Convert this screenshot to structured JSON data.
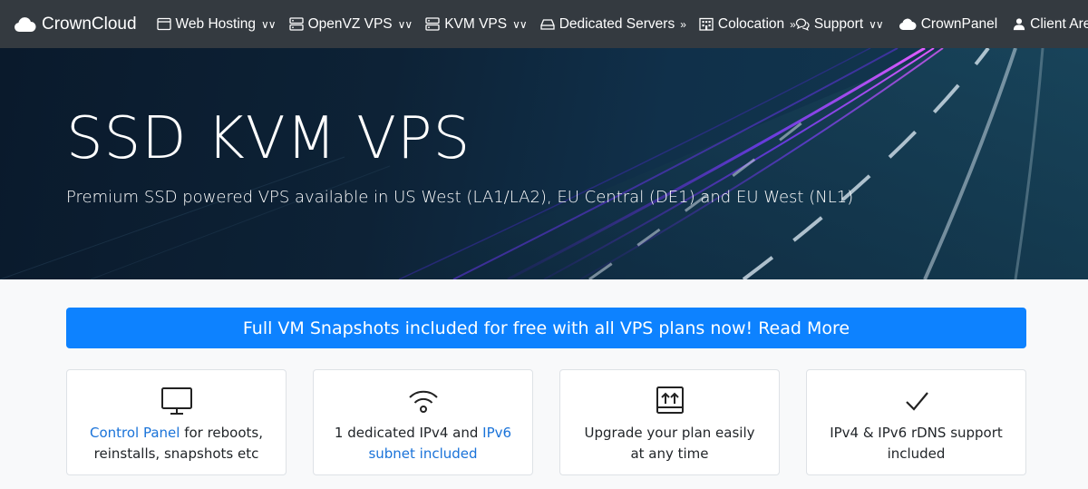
{
  "nav": {
    "brand": "CrownCloud",
    "left": [
      {
        "label": "Web Hosting",
        "icon": "browser-window-icon"
      },
      {
        "label": "OpenVZ VPS",
        "icon": "server-icon"
      },
      {
        "label": "KVM VPS",
        "icon": "server-icon"
      },
      {
        "label": "Dedicated Servers",
        "icon": "hard-drive-icon"
      },
      {
        "label": "Colocation",
        "icon": "building-icon"
      }
    ],
    "right": [
      {
        "label": "Support",
        "icon": "chat-bubbles-icon"
      },
      {
        "label": "CrownPanel",
        "icon": "cloud-icon"
      },
      {
        "label": "Client Area",
        "icon": "user-icon"
      }
    ]
  },
  "hero": {
    "title": "SSD KVM VPS",
    "subtitle": "Premium SSD powered VPS available in US West (LA1/LA2), EU Central (DE1) and EU West (NL1)"
  },
  "banner": {
    "label": "Full VM Snapshots included for free with all VPS plans now! Read More"
  },
  "features": [
    {
      "icon": "monitor-icon",
      "link": "Control Panel",
      "text": " for reboots, reinstalls, snapshots etc"
    },
    {
      "icon": "wifi-icon",
      "pre": "1 dedicated IPv4 and ",
      "link": "IPv6 subnet included"
    },
    {
      "icon": "upgrade-arrows-icon",
      "text": "Upgrade your plan easily at any time"
    },
    {
      "icon": "checkmark-icon",
      "text": "IPv4 & IPv6 rDNS support included"
    }
  ],
  "colors": {
    "navbar": "#343a40",
    "banner": "#0d82ff",
    "link": "#1a73d9"
  }
}
